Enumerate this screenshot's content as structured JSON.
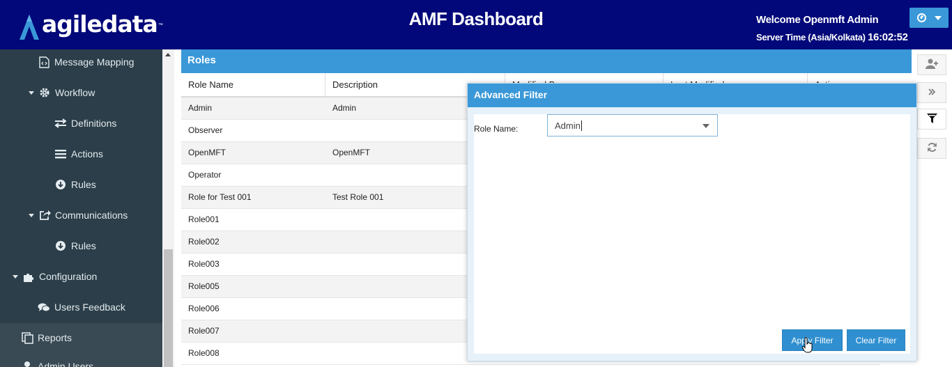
{
  "header": {
    "logo_text": "agiledata",
    "logo_tm": "™",
    "title": "AMF Dashboard",
    "welcome": "Welcome Openmft Admin",
    "server_time_label": "Server Time (Asia/Kolkata)",
    "server_time_value": "16:02:52",
    "user_menu_icon": "settings-icon"
  },
  "sidebar": {
    "message_mapping": "Message Mapping",
    "workflow": "Workflow",
    "definitions": "Definitions",
    "actions": "Actions",
    "workflow_rules": "Rules",
    "communications": "Communications",
    "communications_rules": "Rules",
    "configuration": "Configuration",
    "users_feedback": "Users Feedback",
    "reports": "Reports",
    "admin_users": "Admin Users"
  },
  "roles": {
    "title": "Roles",
    "columns": [
      "Role Name",
      "Description",
      "Modified By",
      "Last Modified",
      "Actions"
    ],
    "rows": [
      {
        "name": "Admin",
        "description": "Admin"
      },
      {
        "name": "Observer",
        "description": ""
      },
      {
        "name": "OpenMFT",
        "description": "OpenMFT"
      },
      {
        "name": "Operator",
        "description": ""
      },
      {
        "name": "Role for Test 001",
        "description": "Test Role 001"
      },
      {
        "name": "Role001",
        "description": ""
      },
      {
        "name": "Role002",
        "description": ""
      },
      {
        "name": "Role003",
        "description": ""
      },
      {
        "name": "Role005",
        "description": ""
      },
      {
        "name": "Role006",
        "description": ""
      },
      {
        "name": "Role007",
        "description": ""
      },
      {
        "name": "Role008",
        "description": ""
      }
    ]
  },
  "toolbar": {
    "add_user_icon": "add-user-icon",
    "expand_icon": "double-chevron-right-icon",
    "filter_icon": "filter-icon",
    "refresh_icon": "refresh-icon"
  },
  "filter_dialog": {
    "title": "Advanced Filter",
    "role_name_label": "Role Name:",
    "role_name_value": "Admin",
    "apply_label": "Apply Filter",
    "clear_label": "Clear Filter"
  },
  "colors": {
    "header_bg": "#020879",
    "accent": "#3a98d8",
    "sidebar_bg": "#2b3e49",
    "button": "#2f8fd0"
  }
}
